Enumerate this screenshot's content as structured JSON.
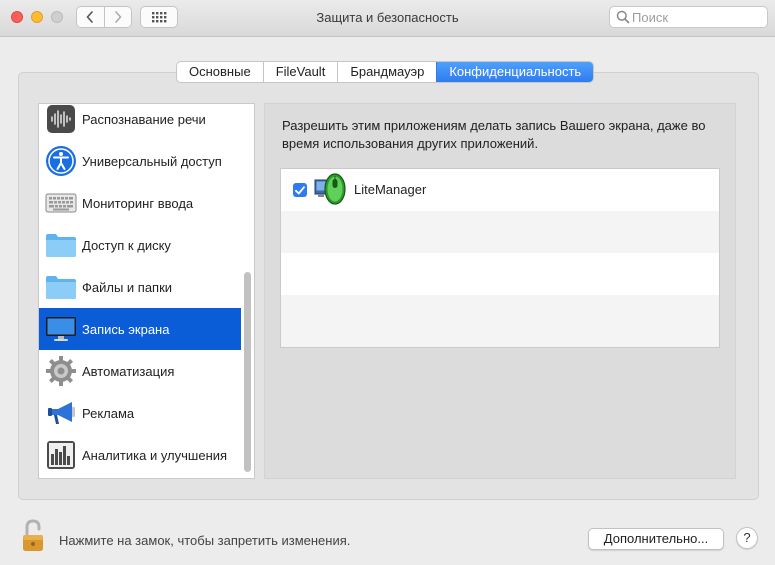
{
  "window": {
    "title": "Защита и безопасность",
    "search_placeholder": "Поиск"
  },
  "tabs": [
    {
      "label": "Основные",
      "active": false
    },
    {
      "label": "FileVault",
      "active": false
    },
    {
      "label": "Брандмауэр",
      "active": false
    },
    {
      "label": "Конфиденциальность",
      "active": true
    }
  ],
  "sidebar": {
    "items": [
      {
        "label": "Распознавание речи",
        "icon": "speech-recognition-icon"
      },
      {
        "label": "Универсальный доступ",
        "icon": "accessibility-icon"
      },
      {
        "label": "Мониторинг ввода",
        "icon": "keyboard-icon"
      },
      {
        "label": "Доступ к диску",
        "icon": "folder-icon"
      },
      {
        "label": "Файлы и папки",
        "icon": "folder-icon"
      },
      {
        "label": "Запись экрана",
        "icon": "display-icon",
        "selected": true
      },
      {
        "label": "Автоматизация",
        "icon": "gear-icon"
      },
      {
        "label": "Реклама",
        "icon": "megaphone-icon"
      },
      {
        "label": "Аналитика и улучшения",
        "icon": "analytics-icon"
      }
    ]
  },
  "main": {
    "description": "Разрешить этим приложениям делать запись Вашего экрана, даже во время использования других приложений.",
    "apps": [
      {
        "name": "LiteManager",
        "checked": true,
        "icon": "litemanager-icon"
      }
    ]
  },
  "footer": {
    "lock_text": "Нажмите на замок, чтобы запретить изменения.",
    "advanced_button": "Дополнительно...",
    "help_button": "?"
  },
  "colors": {
    "accent": "#0a5dd6",
    "tab_active": "#2f7cf0"
  }
}
